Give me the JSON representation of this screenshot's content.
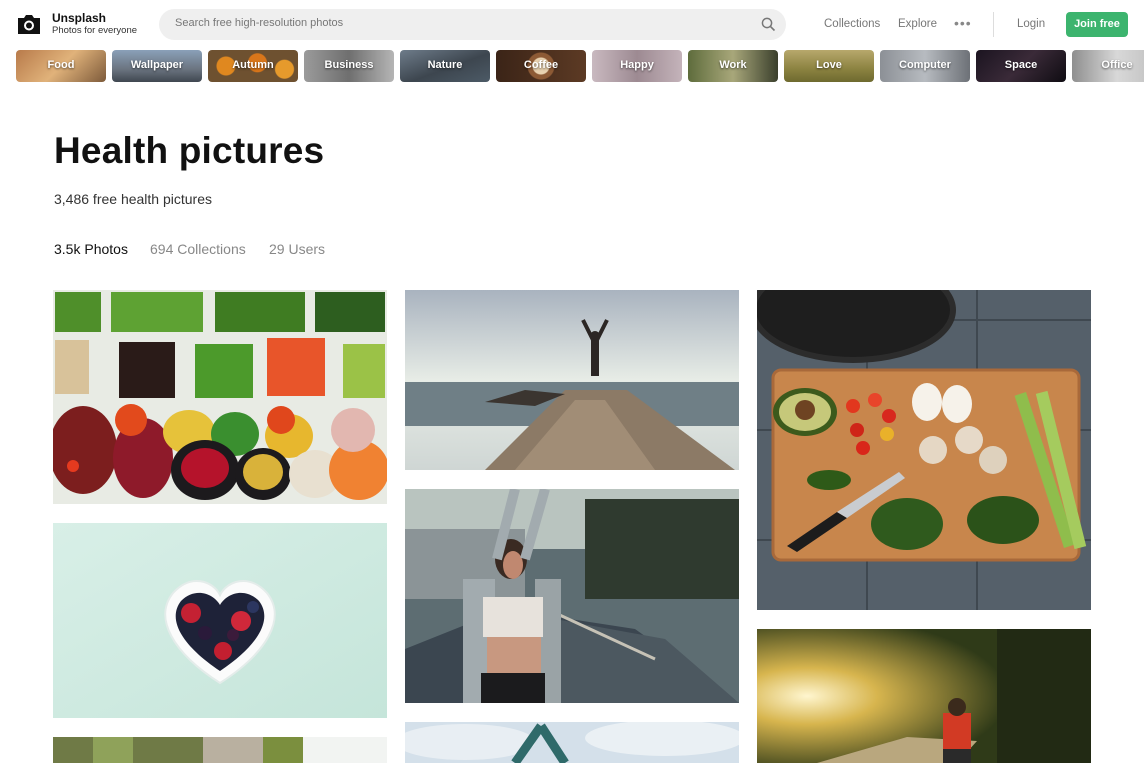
{
  "app": {
    "brand_name": "Unsplash",
    "brand_tagline": "Photos for everyone"
  },
  "header": {
    "search_placeholder": "Search free high-resolution photos",
    "nav": [
      "Collections",
      "Explore"
    ],
    "more_label": "•••",
    "login_label": "Login",
    "join_label": "Join free",
    "join_color": "#3cb46e"
  },
  "topics": [
    "Food",
    "Wallpaper",
    "Autumn",
    "Business",
    "Nature",
    "Coffee",
    "Happy",
    "Work",
    "Love",
    "Computer",
    "Space",
    "Office"
  ],
  "page": {
    "title": "Health pictures",
    "subtitle": "3,486 free health pictures"
  },
  "tabs": [
    {
      "count": "3.5k",
      "label": "Photos",
      "active": true
    },
    {
      "count": "694",
      "label": "Collections",
      "active": false
    },
    {
      "count": "29",
      "label": "Users",
      "active": false
    }
  ],
  "photos": [
    {
      "name": "vegetable-bowls-photo",
      "subject": "vegetables in bowls"
    },
    {
      "name": "heart-berries-photo",
      "subject": "heart bowl of berries"
    },
    {
      "name": "rock-cliff-photo",
      "subject": "rocky cliff"
    },
    {
      "name": "yoga-pier-photo",
      "subject": "yoga pose on pier"
    },
    {
      "name": "woman-stretch-photo",
      "subject": "woman stretching"
    },
    {
      "name": "hands-sky-photo",
      "subject": "hands raised to sky"
    },
    {
      "name": "cutting-board-photo",
      "subject": "vegetables on cutting board"
    },
    {
      "name": "forest-path-photo",
      "subject": "person on forest path"
    }
  ]
}
